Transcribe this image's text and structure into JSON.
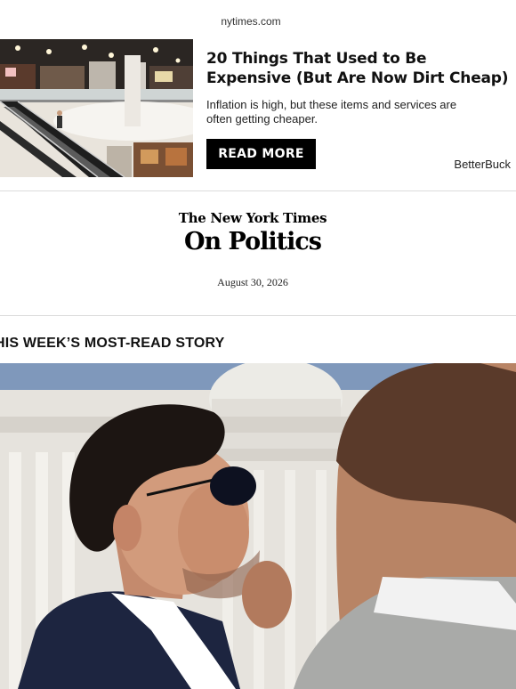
{
  "site": {
    "domain": "nytimes.com"
  },
  "ad": {
    "headline": "20 Things That Used to Be Expensive (But Are Now Dirt Cheap)",
    "body": "Inflation is high, but these items and services are often getting cheaper.",
    "button_label": "READ MORE",
    "sponsor": "BetterBuck",
    "image_subject": "shopping mall interior with escalators"
  },
  "newsletter": {
    "masthead": "The New York Times",
    "title": "On Politics",
    "date": "August 30, 2026"
  },
  "section": {
    "label": "HIS WEEK’S MOST-READ STORY"
  },
  "hero": {
    "image_subject": "man in sunglasses and navy suit outside the U.S. Capitol"
  },
  "colors": {
    "button_bg": "#000000",
    "button_text": "#ffffff",
    "divider": "#dcdcdc"
  }
}
